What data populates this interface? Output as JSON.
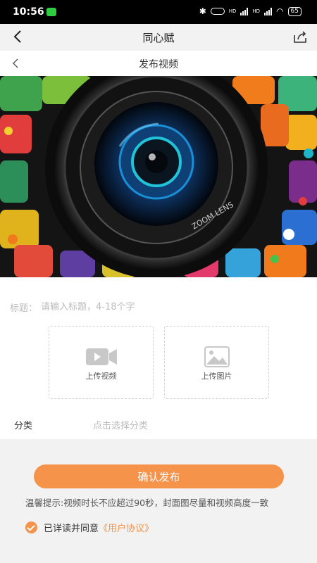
{
  "status_bar": {
    "time": "10:56",
    "network_1": "HD",
    "network_2": "HD",
    "battery": "65"
  },
  "app_header": {
    "title": "同心赋",
    "back_icon": "chevron-left-icon",
    "share_icon": "share-icon"
  },
  "page_header": {
    "title": "发布视频",
    "back_icon": "chevron-left-icon"
  },
  "cover": {
    "lens_text": "ZOOM LENS"
  },
  "form": {
    "title_label": "标题：",
    "title_placeholder": "请输入标题，4-18个字",
    "upload_video_label": "上传视频",
    "upload_image_label": "上传图片",
    "category_label": "分类",
    "category_placeholder": "点击选择分类"
  },
  "footer": {
    "submit_label": "确认发布",
    "tips": "温馨提示:视频时长不应超过90秒，封面图尽量和视频高度一致",
    "agree_text": "已详读并同意",
    "agreement_link": "《用户协议》"
  },
  "colors": {
    "accent": "#f5934a",
    "background": "#f2f2f2"
  }
}
